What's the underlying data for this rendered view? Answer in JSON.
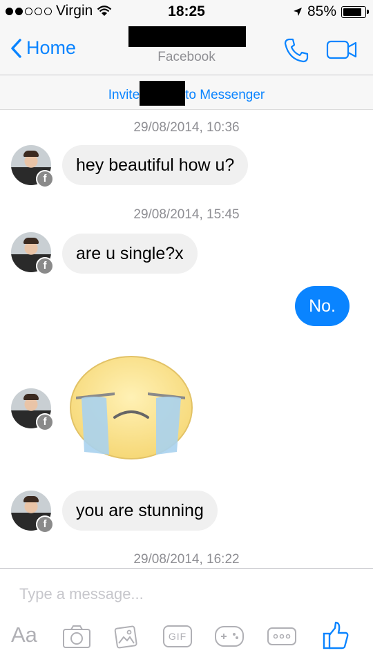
{
  "status": {
    "carrier": "Virgin",
    "time": "18:25",
    "battery": "85%",
    "battery_level": 0.85
  },
  "nav": {
    "back_label": "Home",
    "subtitle": "Facebook"
  },
  "invite": {
    "prefix": "Invite",
    "suffix": "to Messenger"
  },
  "messages": [
    {
      "timestamp": "29/08/2014, 10:36",
      "text": "hey beautiful how u?",
      "direction": "incoming"
    },
    {
      "timestamp": "29/08/2014, 15:45",
      "text": "are u single?x",
      "direction": "incoming"
    },
    {
      "text": "No.",
      "direction": "outgoing"
    },
    {
      "sticker": "crying-face-sticker",
      "direction": "incoming"
    },
    {
      "text": "you are stunning",
      "direction": "incoming"
    },
    {
      "timestamp": "29/08/2014, 16:22"
    }
  ],
  "composer": {
    "placeholder": "Type a message...",
    "tools": {
      "text_label": "Aa",
      "gif_label": "GIF"
    }
  },
  "colors": {
    "accent": "#0a84ff",
    "incoming_bubble": "#f0f0f0",
    "muted": "#8e8e93"
  }
}
